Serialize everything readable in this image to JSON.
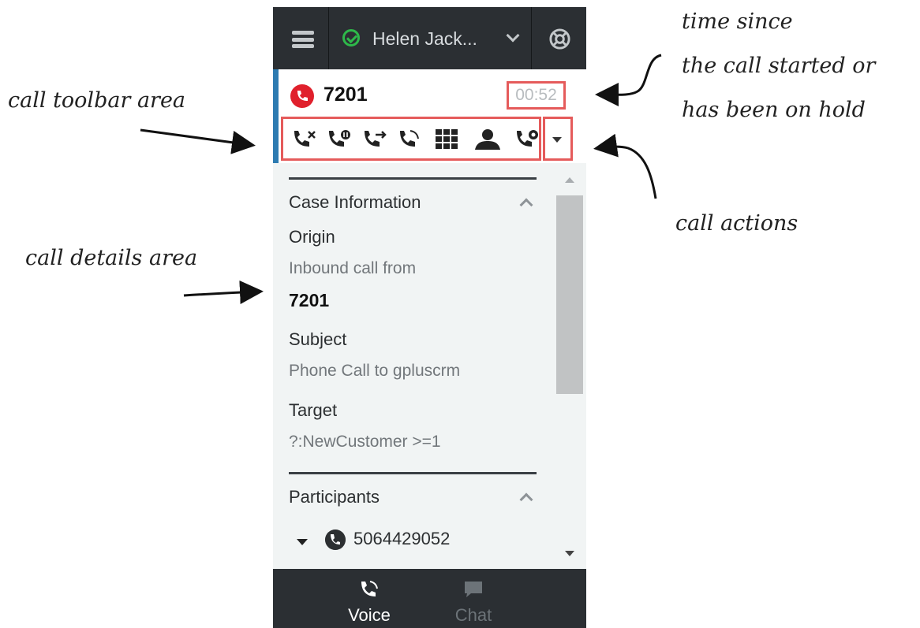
{
  "header": {
    "user_name": "Helen Jack...",
    "status_color": "#2eb84a",
    "icons": [
      "menu-icon",
      "status-available-icon",
      "chevron-down-icon",
      "support-icon"
    ]
  },
  "call": {
    "number": "7201",
    "timer": "00:52",
    "toolbar_icons": [
      "end-call-icon",
      "hold-call-icon",
      "transfer-call-icon",
      "conference-call-icon",
      "keypad-icon",
      "consult-icon",
      "call-recording-icon"
    ],
    "actions_icon": "caret-down-icon"
  },
  "case_info": {
    "title": "Case Information",
    "origin_label": "Origin",
    "origin_value": "Inbound call from",
    "origin_number": "7201",
    "subject_label": "Subject",
    "subject_value": "Phone Call to gpluscrm",
    "target_label": "Target",
    "target_value": "?:NewCustomer >=1"
  },
  "participants": {
    "title": "Participants",
    "items": [
      "5064429052"
    ]
  },
  "tabs": [
    {
      "label": "Voice",
      "active": true
    },
    {
      "label": "Chat",
      "active": false
    }
  ],
  "annotations": {
    "toolbar": "call toolbar area",
    "details": "call details area",
    "time_line1": "time since",
    "time_line2": "the call started or",
    "time_line3": "has been on hold",
    "actions": "call actions"
  },
  "colors": {
    "highlight": "#e55b5b",
    "call_icon": "#e0202c",
    "dark_bar": "#2b2f33",
    "active_bar": "#2d7bb1"
  }
}
